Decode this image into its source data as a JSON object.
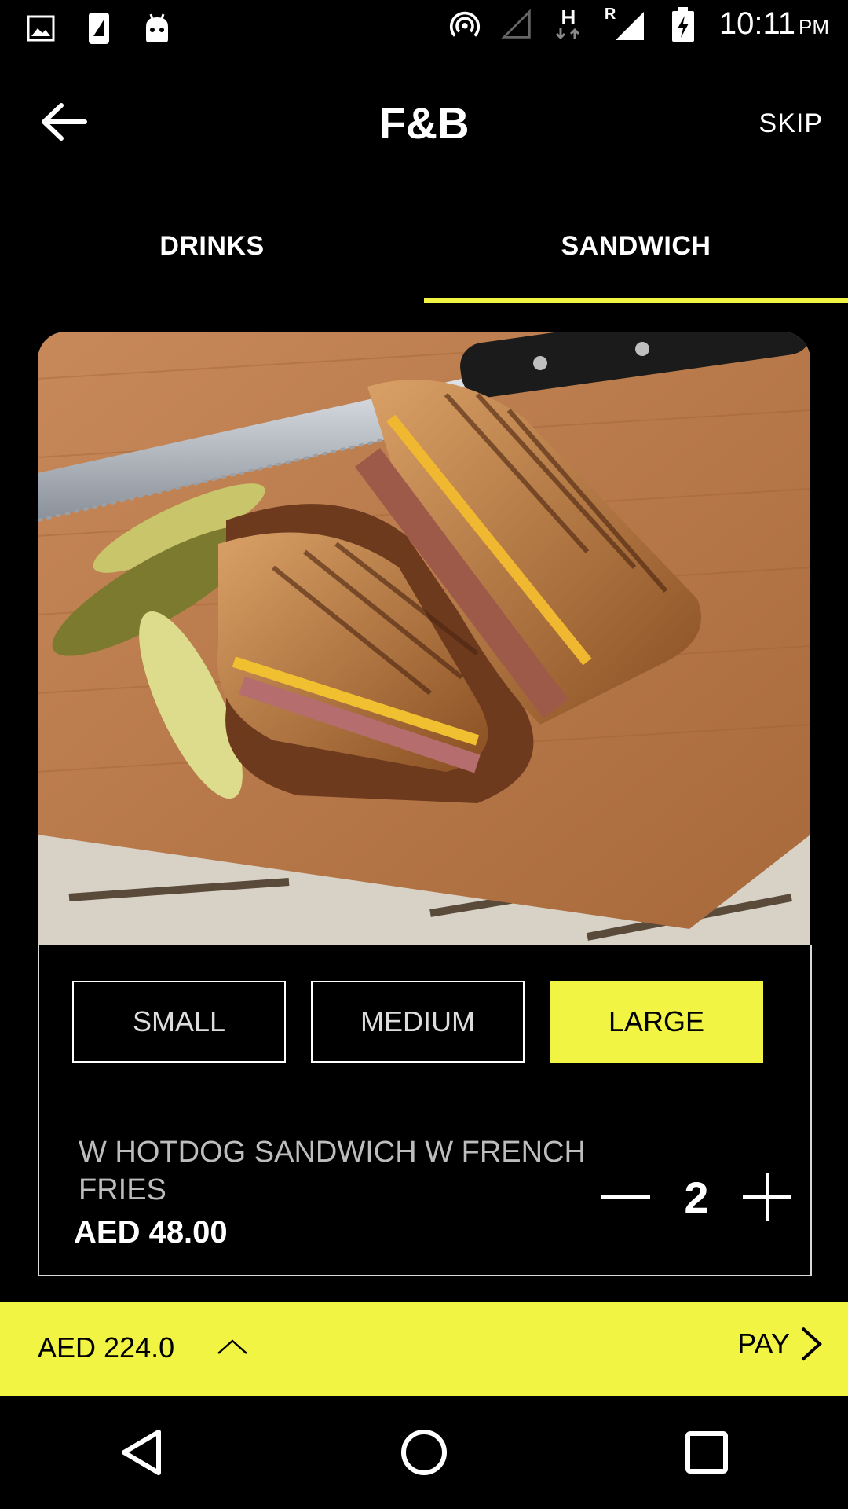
{
  "status_bar": {
    "time": "10:11",
    "ampm": "PM",
    "network_letter": "H",
    "roaming_letter": "R"
  },
  "app_bar": {
    "title": "F&B",
    "skip_label": "SKIP"
  },
  "tabs": [
    {
      "label": "DRINKS",
      "active": false
    },
    {
      "label": "SANDWICH",
      "active": true
    }
  ],
  "product": {
    "image": "grilled-cuban-sandwich-photo",
    "sizes": [
      {
        "label": "SMALL",
        "selected": false
      },
      {
        "label": "MEDIUM",
        "selected": false
      },
      {
        "label": "LARGE",
        "selected": true
      }
    ],
    "name": "W HOTDOG SANDWICH W FRENCH FRIES",
    "price": "AED 48.00",
    "quantity": "2"
  },
  "pay_bar": {
    "total": "AED 224.0",
    "pay_label": "PAY"
  },
  "colors": {
    "accent": "#f1f443",
    "background": "#000000",
    "muted_text": "#bdbdbd"
  },
  "icons": [
    "image-icon",
    "sim-icon",
    "android-icon",
    "hotspot-icon",
    "signal-icon",
    "battery-charging-icon",
    "back-arrow-icon",
    "minus-icon",
    "plus-icon",
    "chevron-up-icon",
    "chevron-right-icon",
    "nav-back-icon",
    "nav-home-icon",
    "nav-recents-icon"
  ]
}
